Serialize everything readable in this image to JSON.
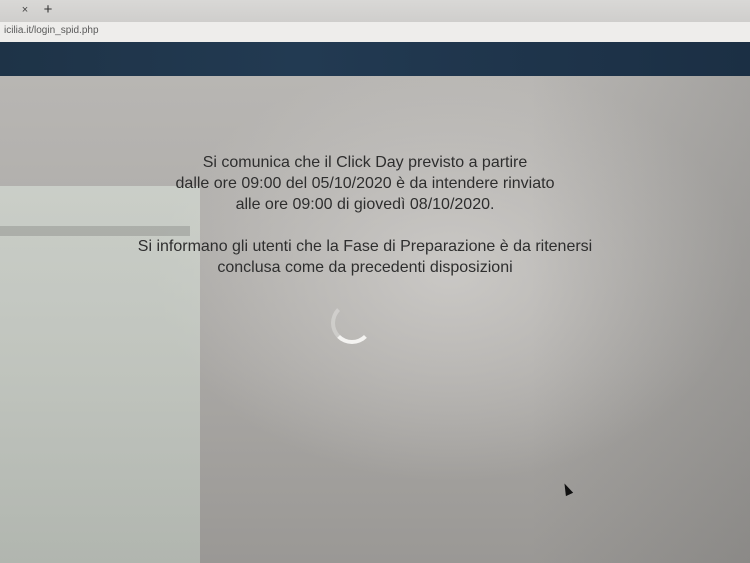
{
  "browser": {
    "tab_close": "×",
    "new_tab": "+",
    "url": "icilia.it/login_spid.php"
  },
  "message": {
    "line1": "Si comunica che il Click Day previsto a partire",
    "line2": "dalle ore 09:00 del 05/10/2020 è da intendere rinviato",
    "line3": "alle ore 09:00 di giovedì 08/10/2020.",
    "line4": "Si informano gli utenti che la Fase di Preparazione è da ritenersi",
    "line5": "conclusa come da precedenti disposizioni"
  },
  "icons": {
    "spinner": "loading-spinner-icon",
    "cursor": "mouse-cursor-icon"
  }
}
